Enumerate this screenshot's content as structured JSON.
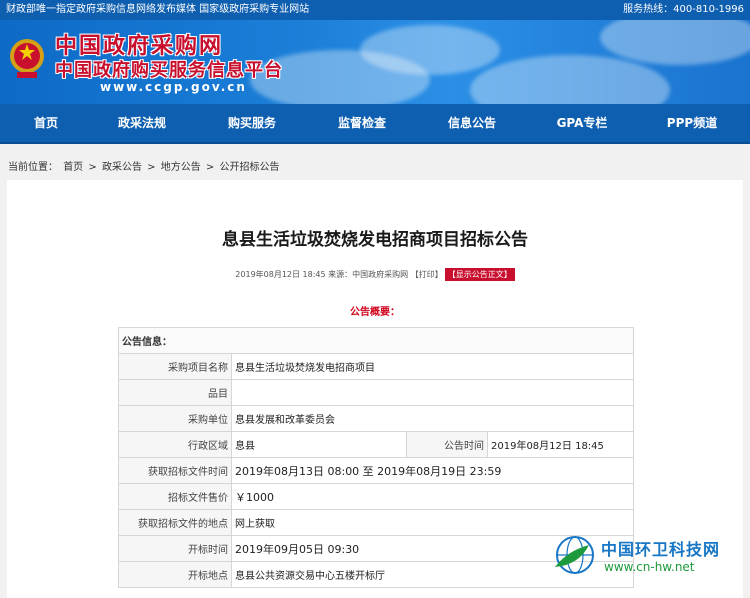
{
  "top_bar": {
    "left_text": "财政部唯一指定政府采购信息网络发布媒体  国家级政府采购专业网站",
    "hotline": "服务热线：400-810-1996"
  },
  "brand": {
    "name_cn": "中国政府采购网",
    "subtitle_cn": "中国政府购买服务信息平台",
    "url": "www.ccgp.gov.cn"
  },
  "nav": {
    "items": [
      "首页",
      "政采法规",
      "购买服务",
      "监督检查",
      "信息公告",
      "GPA专栏",
      "PPP频道"
    ]
  },
  "breadcrumb": {
    "prefix": "当前位置：",
    "items": [
      "首页",
      "政采公告",
      "地方公告",
      "公开招标公告"
    ],
    "separator": ">"
  },
  "article": {
    "title": "息县生活垃圾焚烧发电招商项目招标公告",
    "meta_text": "2019年08月12日 18:45 来源：中国政府采购网 【打印】",
    "show_full_button": "【显示公告正文】",
    "overview_label": "公告概要："
  },
  "info_table": {
    "header": "公告信息：",
    "rows": {
      "project_name_label": "采购项目名称",
      "project_name": "息县生活垃圾焚烧发电招商项目",
      "item_label": "品目",
      "item_value": "",
      "purchaser_label": "采购单位",
      "purchaser": "息县发展和改革委员会",
      "region_label": "行政区域",
      "region": "息县",
      "publish_time_label": "公告时间",
      "publish_time": "2019年08月12日 18:45",
      "doc_time_label": "获取招标文件时间",
      "doc_time": "2019年08月13日 08:00  至  2019年08月19日 23:59",
      "doc_price_label": "招标文件售价",
      "doc_price": "￥1000",
      "doc_place_label": "获取招标文件的地点",
      "doc_place": "网上获取",
      "open_time_label": "开标时间",
      "open_time": "2019年09月05日 09:30",
      "open_place_label": "开标地点",
      "open_place": "息县公共资源交易中心五楼开标厅"
    }
  },
  "watermark": {
    "name": "中国环卫科技网",
    "url": "www.cn-hw.net"
  },
  "colors": {
    "nav_blue": "#0f5fb0",
    "brand_red": "#c8102e",
    "overview_red": "#d0021b",
    "watermark_blue": "#1776c5",
    "watermark_green": "#1d9a3e"
  }
}
